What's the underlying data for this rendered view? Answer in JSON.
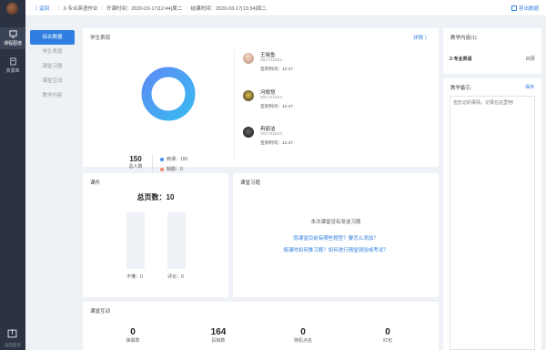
{
  "rail": {
    "nav_classroom": "课程图谱",
    "nav_resources": "资源库",
    "bottom_label": "返回首页"
  },
  "header": {
    "back": "返回",
    "course": "2-专业英语作业",
    "start_time": "开课时间：2020-03-17|12:44|周二",
    "end_time": "结课时间：2020-03-17|13:34|周二",
    "export": "导出数据"
  },
  "subnav": [
    "综合数据",
    "学生表现",
    "课堂习题",
    "课堂互动",
    "教学内容"
  ],
  "performance": {
    "title": "学生表现",
    "detail": "详情 〉",
    "total": "150",
    "total_label": "总人数",
    "present": "到课：150",
    "absent": "缺勤：0",
    "colors": {
      "present": "#3d8ef0",
      "absent": "#f0876a"
    },
    "students": [
      {
        "name": "王晓鱼",
        "id": "201741622",
        "time": "签到时间：12:47"
      },
      {
        "name": "冯叙恺",
        "id": "201741624",
        "time": "签到时间：12:47"
      },
      {
        "name": "冉丽洁",
        "id": "201741610",
        "time": "签到时间：12:47"
      }
    ]
  },
  "teaching": {
    "title": "教学内容(1)",
    "course": "2-专业英语",
    "pages": "10页"
  },
  "notes": {
    "title": "教学备忘:",
    "save": "保存",
    "placeholder": "但忘记的事情，记录在这里吧!"
  },
  "courseware": {
    "title": "课件",
    "total_pages": "总页数：10",
    "unclear": "不懂：0",
    "comments": "评论：0"
  },
  "exercises": {
    "title": "课堂习题",
    "none": "本次课堂没有发送习题",
    "q1": "雨课堂目前有哪些题型？要怎么添加？",
    "q2": "授课时如何推习题？如何进行随堂测验或考试？"
  },
  "interaction": {
    "title": "课堂互动",
    "stats": [
      {
        "value": "0",
        "label": "弹幕数"
      },
      {
        "value": "164",
        "label": "投稿数"
      },
      {
        "value": "0",
        "label": "随机点名"
      },
      {
        "value": "0",
        "label": "红包"
      }
    ]
  }
}
